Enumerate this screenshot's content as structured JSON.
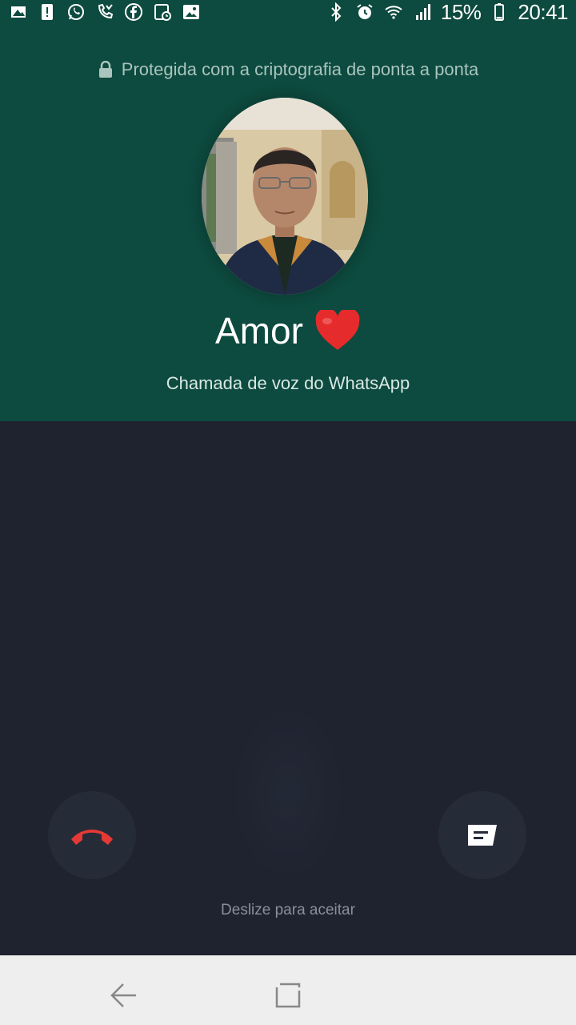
{
  "status_bar": {
    "battery_percent": "15%",
    "time": "20:41",
    "left_icons": [
      "sim-card-icon",
      "alert-icon",
      "whatsapp-icon",
      "missed-call-icon",
      "facebook-icon",
      "image-clock-icon",
      "gallery-icon"
    ],
    "right_icons": [
      "bluetooth-icon",
      "alarm-icon",
      "wifi-icon",
      "signal-icon",
      "battery-icon"
    ]
  },
  "call": {
    "encryption_text": "Protegida com a criptografia de ponta a ponta",
    "contact_name": "Amor",
    "call_type": "Chamada de voz do WhatsApp",
    "swipe_hint": "Deslize para aceitar"
  },
  "colors": {
    "header_bg": "#0d4a3f",
    "body_bg": "#1f2330",
    "decline_red": "#e53935",
    "nav_bg": "#eeeeee"
  }
}
